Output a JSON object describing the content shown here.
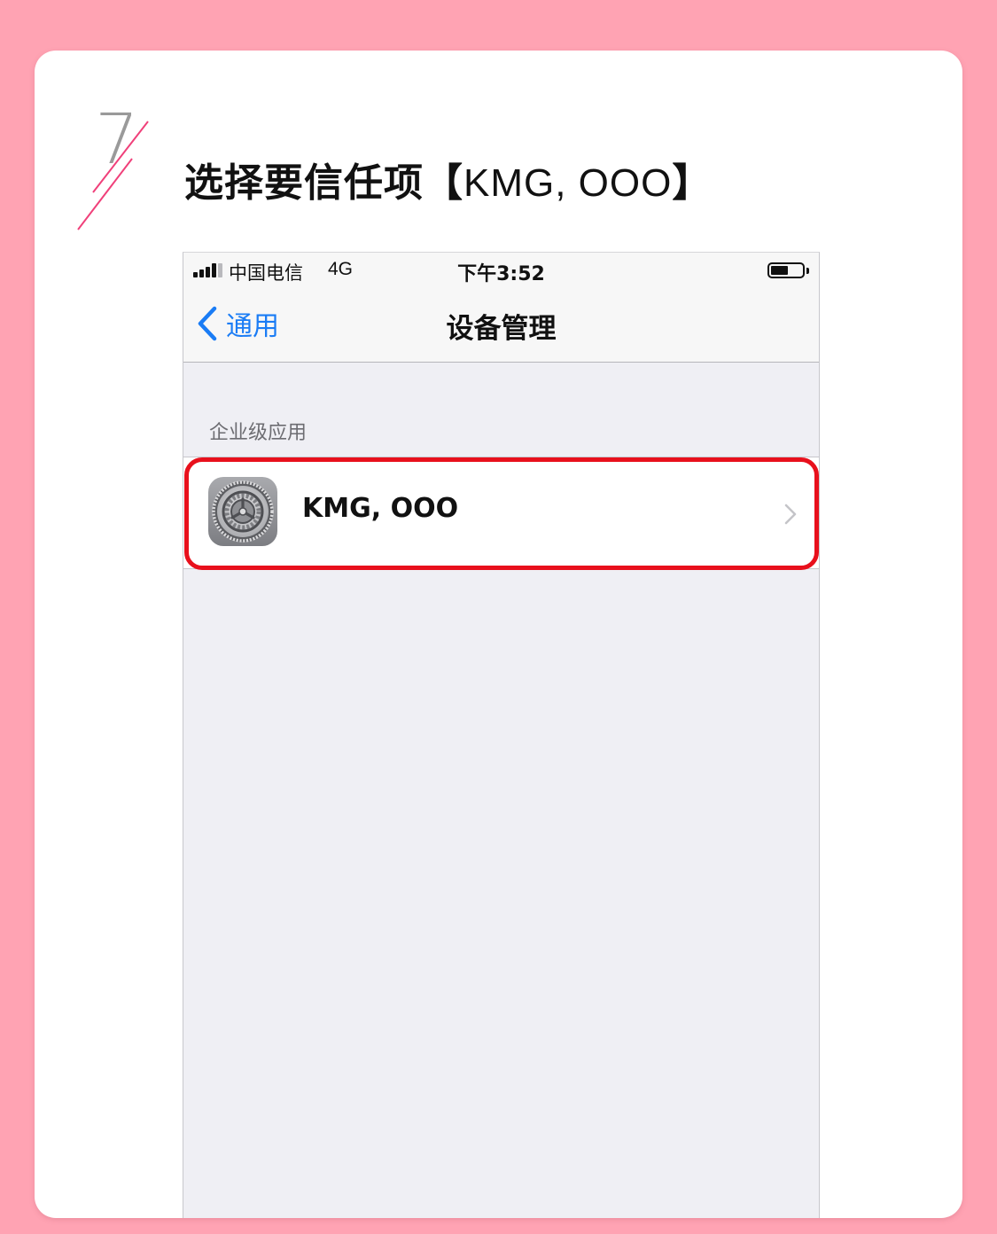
{
  "step": {
    "number": "7",
    "title_prefix": "选择要信任项【",
    "title_name": "KMG, OOO",
    "title_suffix": "】"
  },
  "status_bar": {
    "carrier": "中国电信",
    "network": "4G",
    "time": "下午3:52",
    "battery_level_percent": 55
  },
  "nav": {
    "back_label": "通用",
    "title": "设备管理"
  },
  "section": {
    "header": "企业级应用",
    "items": [
      {
        "label": "KMG, OOO",
        "icon": "settings-gear-icon"
      }
    ]
  },
  "colors": {
    "page_background": "#ffa3b3",
    "ios_blue": "#1a7cf5",
    "highlight_red": "#e8101c",
    "accent_pink": "#f0407a"
  }
}
